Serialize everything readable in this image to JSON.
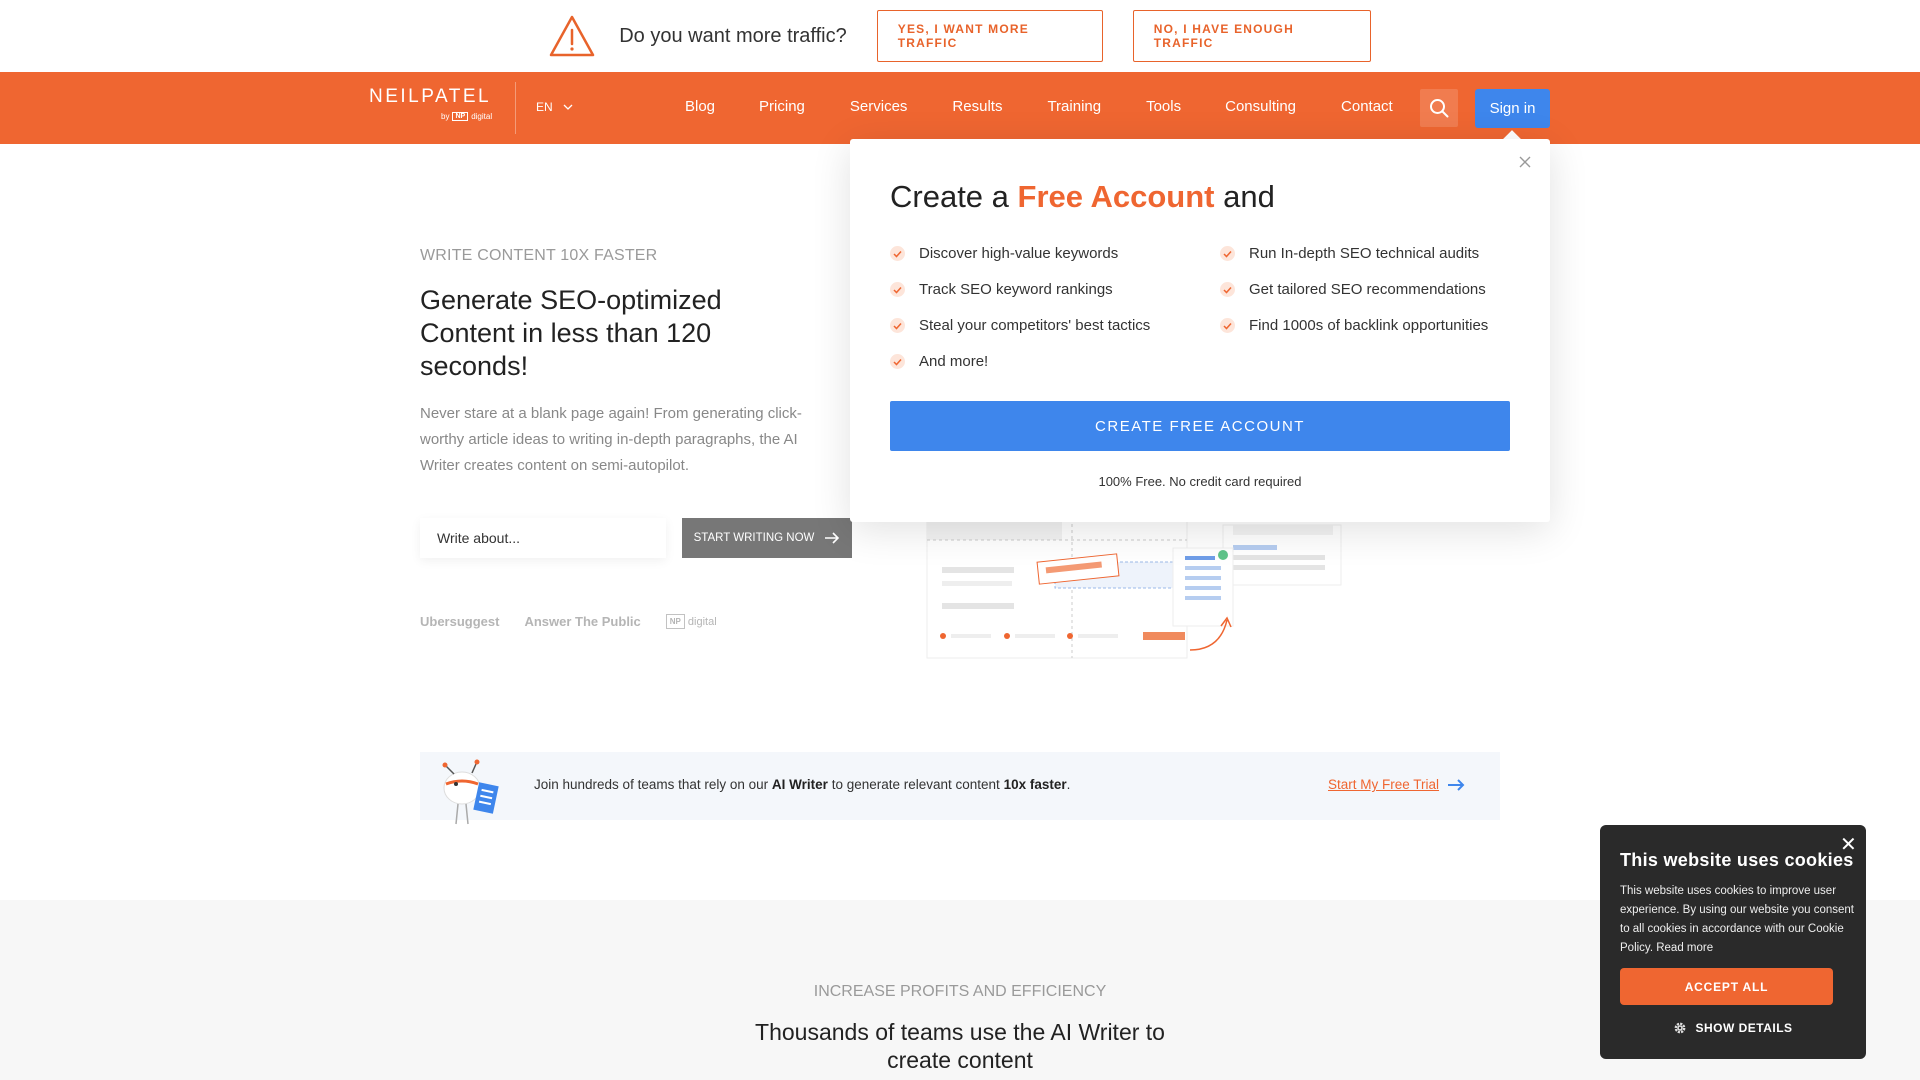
{
  "topbar": {
    "question": "Do you want more traffic?",
    "yes_label": "YES, I WANT MORE TRAFFIC",
    "no_label": "NO, I HAVE ENOUGH TRAFFIC"
  },
  "nav": {
    "logo": "NEILPATEL",
    "logo_by": "by",
    "logo_np": "NP",
    "logo_digital": "digital",
    "lang": "EN",
    "items": [
      "Blog",
      "Pricing",
      "Services",
      "Results",
      "Training",
      "Tools",
      "Consulting",
      "Contact"
    ],
    "signin": "Sign in"
  },
  "hero": {
    "eyebrow": "WRITE CONTENT 10X FASTER",
    "title": "Generate SEO-optimized Content in less than 120 seconds!",
    "description": "Never stare at a blank page again! From generating click-worthy article ideas to writing in-depth paragraphs, the AI Writer creates content on semi-autopilot.",
    "input_placeholder": "Write about...",
    "cta": "START WRITING NOW",
    "partners": [
      "Ubersuggest",
      "Answer The Public"
    ],
    "partner_np": "NP",
    "partner_digital": "digital"
  },
  "popup": {
    "title_prefix": "Create a",
    "title_accent": "Free Account",
    "title_suffix": "and",
    "features_left": [
      "Discover high-value keywords",
      "Track SEO keyword rankings",
      "Steal your competitors' best tactics",
      "And more!"
    ],
    "features_right": [
      "Run In-depth SEO technical audits",
      "Get tailored SEO recommendations",
      "Find 1000s of backlink opportunities"
    ],
    "button": "CREATE FREE ACCOUNT",
    "note": "100% Free. No credit card required"
  },
  "promo": {
    "text_1": "Join hundreds of teams that rely on our",
    "text_bold_1": "AI Writer",
    "text_2": "to generate relevant content",
    "text_bold_2": "10x faster",
    "text_3": ".",
    "link": "Start My Free Trial"
  },
  "lower": {
    "eyebrow": "INCREASE PROFITS AND EFFICIENCY",
    "title_line1": "Thousands of teams use the AI Writer to",
    "title_line2": "create content"
  },
  "cookie": {
    "title": "This website uses cookies",
    "text": "This website uses cookies to improve user experience. By using our website you consent to all cookies in accordance with our Cookie Policy.",
    "read_more": "Read more",
    "accept": "ACCEPT ALL",
    "details": "SHOW DETAILS"
  },
  "colors": {
    "brand_orange": "#ef6631",
    "primary_blue": "#3e86ec",
    "cookie_bg": "#2a2a2a"
  },
  "icons": [
    "warning-triangle-icon",
    "chevron-down-icon",
    "search-icon",
    "close-icon",
    "check-icon",
    "arrow-right-icon",
    "gear-icon"
  ]
}
